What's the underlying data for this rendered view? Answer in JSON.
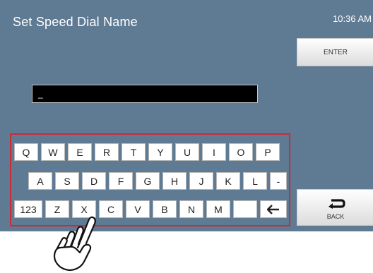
{
  "header": {
    "title": "Set Speed Dial Name",
    "time": "10:36 AM"
  },
  "buttons": {
    "enter_label": "ENTER",
    "back_label": "BACK"
  },
  "name_field": {
    "value": "_"
  },
  "keyboard": {
    "row1": [
      "Q",
      "W",
      "E",
      "R",
      "T",
      "Y",
      "U",
      "I",
      "O",
      "P"
    ],
    "row2": [
      "A",
      "S",
      "D",
      "F",
      "G",
      "H",
      "J",
      "K",
      "L",
      "-"
    ],
    "row3": [
      "123",
      "Z",
      "X",
      "C",
      "V",
      "B",
      "N",
      "M"
    ],
    "space_label": "",
    "backspace_icon": "left-arrow-icon"
  },
  "colors": {
    "screen_bg": "#5f7a93",
    "highlight_frame": "#cc2a36"
  }
}
